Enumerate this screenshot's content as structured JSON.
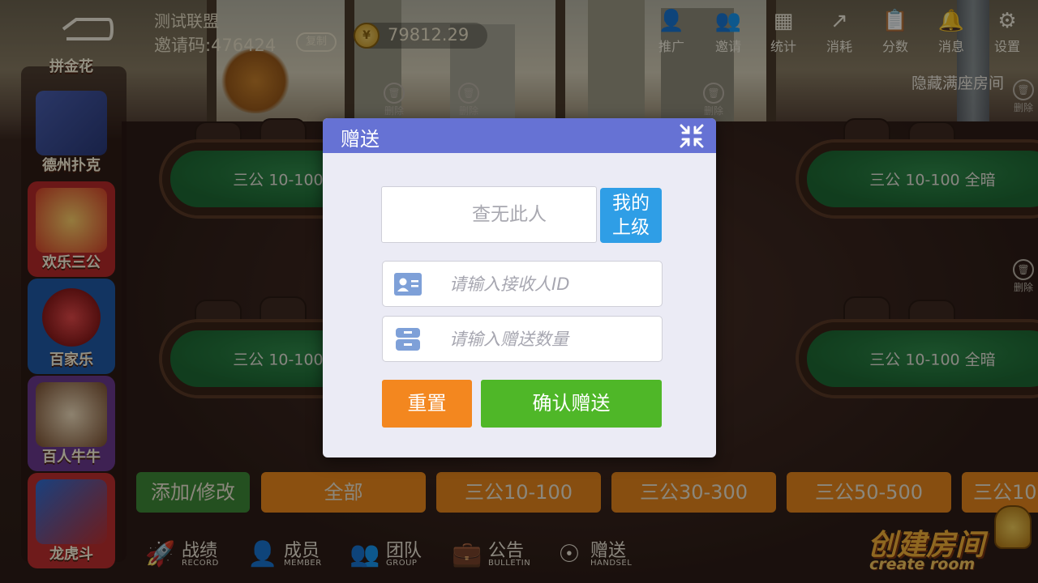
{
  "topbar": {
    "club_name": "测试联盟",
    "invite_code": "邀请码:476424",
    "copy_label": "复制",
    "coin_amount": "79812.29",
    "buttons": [
      {
        "label": "推广",
        "icon": "person-icon"
      },
      {
        "label": "邀请",
        "icon": "add-person-icon"
      },
      {
        "label": "统计",
        "icon": "bar-chart-icon"
      },
      {
        "label": "消耗",
        "icon": "trend-chart-icon"
      },
      {
        "label": "分数",
        "icon": "clipboard-icon"
      },
      {
        "label": "消息",
        "icon": "bell-icon"
      },
      {
        "label": "设置",
        "icon": "gear-icon"
      }
    ]
  },
  "sidebar": {
    "games": [
      {
        "label": "拼金花"
      },
      {
        "label": "德州扑克"
      },
      {
        "label": "欢乐三公"
      },
      {
        "label": "百家乐"
      },
      {
        "label": "百人牛牛"
      },
      {
        "label": "龙虎斗"
      }
    ]
  },
  "lobby": {
    "hide_full": "隐藏满座房间",
    "delete_label": "删除",
    "tables": [
      {
        "label": "三公 10-100 全暗"
      },
      {
        "label": "三公 10-100 全暗"
      },
      {
        "label": "三公 10-100 全暗"
      },
      {
        "label": "三公 10-100 全暗"
      }
    ]
  },
  "filters": {
    "add_edit": "添加/修改",
    "chips": [
      "全部",
      "三公10-100",
      "三公30-300",
      "三公50-500",
      "三公10"
    ]
  },
  "bottom_nav": [
    {
      "label": "战绩",
      "sub": "RECORD",
      "icon": "rocket-icon"
    },
    {
      "label": "成员",
      "sub": "MEMBER",
      "icon": "member-icon"
    },
    {
      "label": "团队",
      "sub": "GROUP",
      "icon": "group-icon"
    },
    {
      "label": "公告",
      "sub": "BULLETIN",
      "icon": "bulletin-icon"
    },
    {
      "label": "赠送",
      "sub": "HANDSEL",
      "icon": "handsel-icon"
    }
  ],
  "create_room": {
    "cn": "创建房间",
    "en": "create room"
  },
  "modal": {
    "title": "赠送",
    "search_result": "查无此人",
    "superior_button": [
      "我的",
      "上级"
    ],
    "receiver_placeholder": "请输入接收人ID",
    "amount_placeholder": "请输入赠送数量",
    "reset_label": "重置",
    "confirm_label": "确认赠送"
  },
  "colors": {
    "modal_header": "#6672d4",
    "superior_button": "#2f9ee6",
    "reset_button": "#f3871f",
    "confirm_button": "#4fb728",
    "table_felt": "#1e6a34",
    "filter_active": "#f08a1c"
  }
}
